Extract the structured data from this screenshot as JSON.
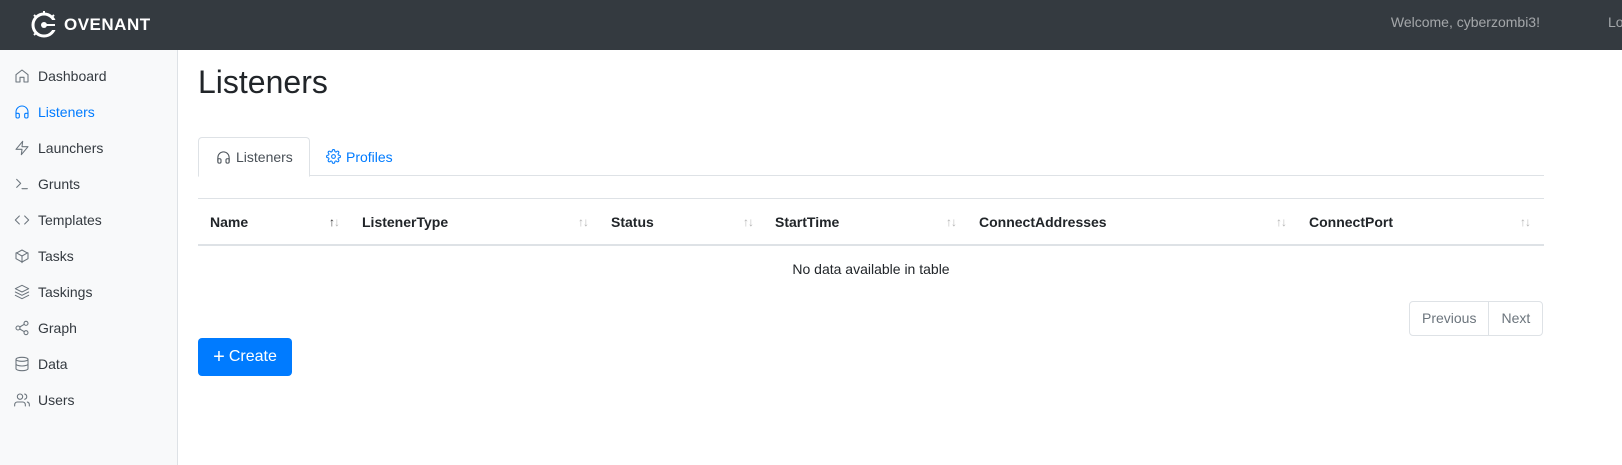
{
  "header": {
    "brand": "OVENANT",
    "welcome": "Welcome, cyberzombi3!",
    "logout": "Lo"
  },
  "sidebar": {
    "items": [
      {
        "label": "Dashboard",
        "icon": "home-icon"
      },
      {
        "label": "Listeners",
        "icon": "headphones-icon",
        "active": true
      },
      {
        "label": "Launchers",
        "icon": "zap-icon"
      },
      {
        "label": "Grunts",
        "icon": "terminal-icon"
      },
      {
        "label": "Templates",
        "icon": "code-icon"
      },
      {
        "label": "Tasks",
        "icon": "box-icon"
      },
      {
        "label": "Taskings",
        "icon": "layers-icon"
      },
      {
        "label": "Graph",
        "icon": "share-icon"
      },
      {
        "label": "Data",
        "icon": "database-icon"
      },
      {
        "label": "Users",
        "icon": "users-icon"
      }
    ]
  },
  "main": {
    "title": "Listeners",
    "tabs": [
      {
        "label": "Listeners",
        "icon": "headphones-icon",
        "active": true
      },
      {
        "label": "Profiles",
        "icon": "gear-icon"
      }
    ],
    "table": {
      "columns": [
        "Name",
        "ListenerType",
        "Status",
        "StartTime",
        "ConnectAddresses",
        "ConnectPort"
      ],
      "sorted_column": "Name",
      "empty_message": "No data available in table"
    },
    "pagination": {
      "previous": "Previous",
      "next": "Next"
    },
    "create_button": "Create"
  },
  "colors": {
    "topbar": "#343a40",
    "accent": "#007bff",
    "sidebar_bg": "#f8f9fa"
  }
}
